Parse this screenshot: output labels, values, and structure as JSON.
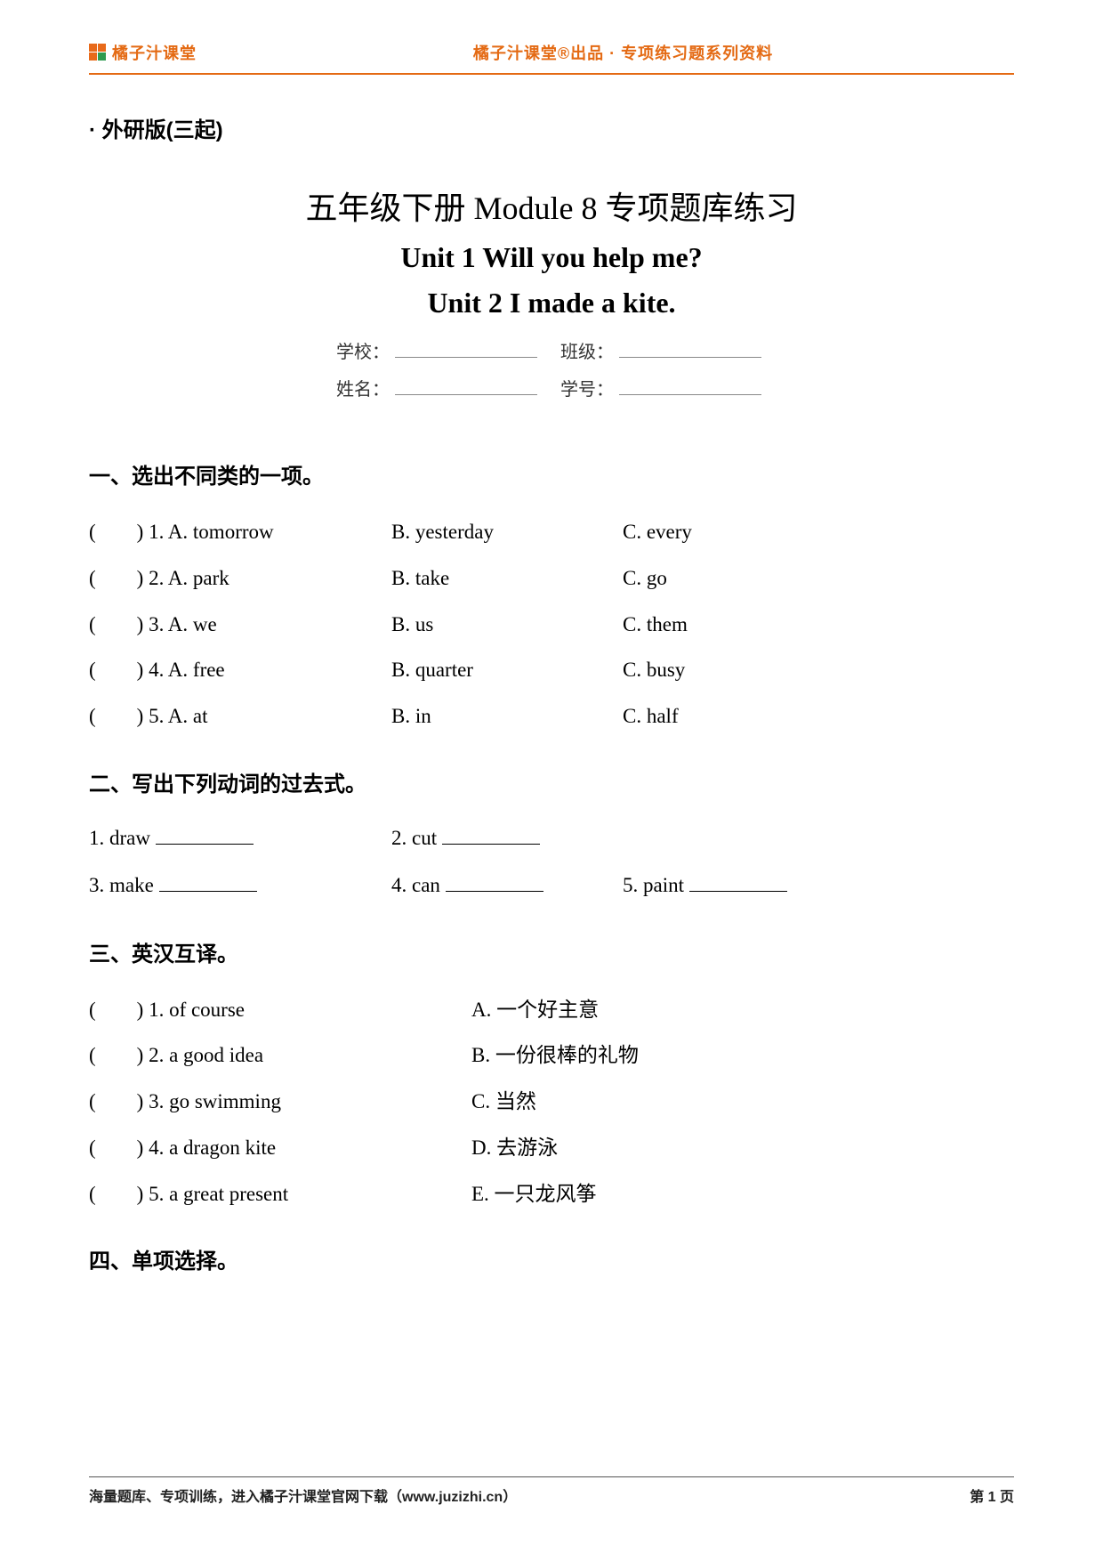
{
  "header": {
    "brand": "橘子汁课堂",
    "center": "橘子汁课堂®出品 · 专项练习题系列资料"
  },
  "edition": "· 外研版(三起)",
  "title": {
    "line1": "五年级下册 Module 8 专项题库练习",
    "line2": "Unit 1 Will you help me?",
    "line3": "Unit 2 I made a kite."
  },
  "info": {
    "school_label": "学校：",
    "class_label": "班级：",
    "name_label": "姓名：",
    "id_label": "学号："
  },
  "s1": {
    "title": "一、选出不同类的一项。",
    "rows": [
      {
        "a": "(  ) 1. A. tomorrow",
        "b": "B. yesterday",
        "c": "C. every"
      },
      {
        "a": "(  ) 2. A. park",
        "b": "B. take",
        "c": "C. go"
      },
      {
        "a": "(  ) 3. A. we",
        "b": "B. us",
        "c": "C. them"
      },
      {
        "a": "(  ) 4. A. free",
        "b": "B. quarter",
        "c": "C. busy"
      },
      {
        "a": "(  ) 5. A. at",
        "b": "B. in",
        "c": "C. half"
      }
    ]
  },
  "s2": {
    "title": "二、写出下列动词的过去式。",
    "items": {
      "i1": "1. draw ",
      "i2": "2. cut ",
      "i3": "3. make ",
      "i4": "4. can ",
      "i5": "5. paint "
    }
  },
  "s3": {
    "title": "三、英汉互译。",
    "rows": [
      {
        "l": "(  ) 1. of course",
        "r": "A.  一个好主意"
      },
      {
        "l": "(  ) 2. a good idea",
        "r": "B.  一份很棒的礼物"
      },
      {
        "l": "(  ) 3. go swimming",
        "r": "C.  当然"
      },
      {
        "l": "(  ) 4. a dragon kite",
        "r": "D.  去游泳"
      },
      {
        "l": "(  ) 5. a great present",
        "r": "E.  一只龙风筝"
      }
    ]
  },
  "s4": {
    "title": "四、单项选择。"
  },
  "footer": {
    "left": "海量题库、专项训练，进入橘子汁课堂官网下载（www.juzizhi.cn）",
    "right": "第 1 页"
  }
}
